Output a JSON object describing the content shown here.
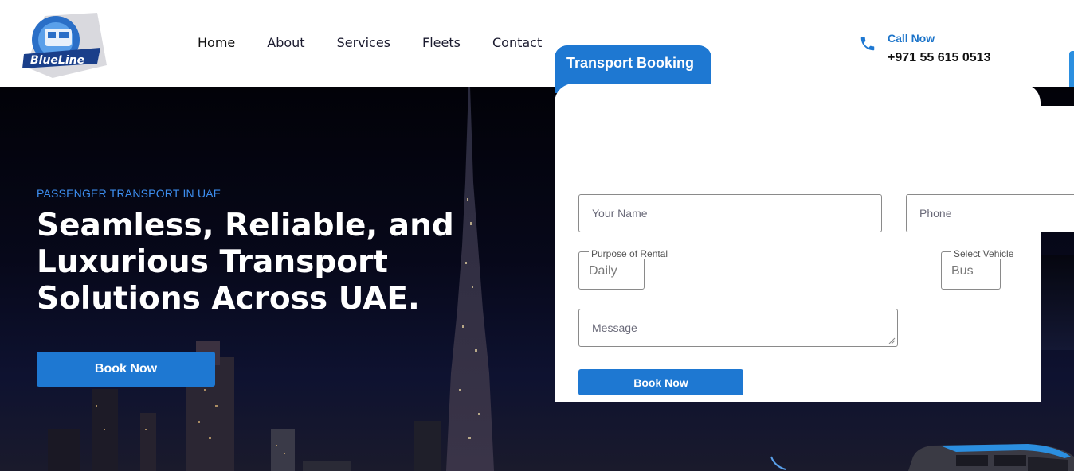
{
  "brand": {
    "logo_text": "BlueLine"
  },
  "nav": {
    "items": [
      "Home",
      "About",
      "Services",
      "Fleets",
      "Contact"
    ]
  },
  "contact": {
    "label": "Call Now",
    "number": "+971 55 615 0513"
  },
  "hero": {
    "tagline": "PASSENGER TRANSPORT IN UAE",
    "title": "Seamless, Reliable, and Luxurious Transport Solutions Across UAE.",
    "cta": "Book Now"
  },
  "booking": {
    "tab_title": "Transport Booking",
    "name_placeholder": "Your Name",
    "phone_placeholder": "Phone",
    "purpose_label": "Purpose of Rental",
    "purpose_value": "Daily",
    "vehicle_label": "Select Vehicle",
    "vehicle_value": "Bus",
    "message_placeholder": "Message",
    "submit": "Book Now"
  },
  "colors": {
    "accent": "#1e78d2",
    "link": "#3d8ef0",
    "text": "#111111"
  },
  "icons": {
    "phone": "phone-icon",
    "logo": "logo-icon"
  }
}
